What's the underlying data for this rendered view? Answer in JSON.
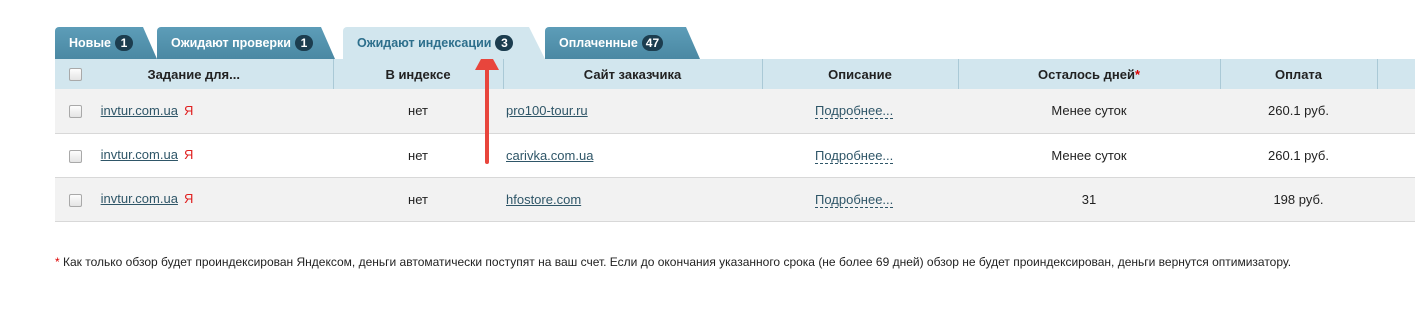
{
  "tabs": [
    {
      "label": "Новые",
      "count": "1"
    },
    {
      "label": "Ожидают проверки",
      "count": "1"
    },
    {
      "label": "Ожидают индексации",
      "count": "3"
    },
    {
      "label": "Оплаченные",
      "count": "47"
    }
  ],
  "table": {
    "headers": {
      "task": "Задание для...",
      "indexed": "В индексе",
      "site": "Сайт заказчика",
      "description": "Описание",
      "days_left": "Осталось дней",
      "days_left_star": "*",
      "payment": "Оплата"
    },
    "rows": [
      {
        "task": "invtur.com.ua",
        "engine": "Я",
        "indexed": "нет",
        "site": "pro100-tour.ru",
        "description": "Подробнее...",
        "days_left": "Менее суток",
        "payment": "260.1 руб."
      },
      {
        "task": "invtur.com.ua",
        "engine": "Я",
        "indexed": "нет",
        "site": "carivka.com.ua",
        "description": "Подробнее...",
        "days_left": "Менее суток",
        "payment": "260.1 руб."
      },
      {
        "task": "invtur.com.ua",
        "engine": "Я",
        "indexed": "нет",
        "site": "hfostore.com",
        "description": "Подробнее...",
        "days_left": "31",
        "payment": "198 руб."
      }
    ]
  },
  "footnote": {
    "star": "*",
    "text": "Как только обзор будет проиндексирован Яндексом, деньги автоматически поступят на ваш счет. Если до окончания указанного срока (не более 69 дней) обзор не будет проиндексирован, деньги вернутся оптимизатору."
  },
  "colors": {
    "tab_dark": "#4a88a3",
    "tab_active": "#d2e6ee",
    "arrow": "#e8453c",
    "yandex": "#e02020"
  }
}
